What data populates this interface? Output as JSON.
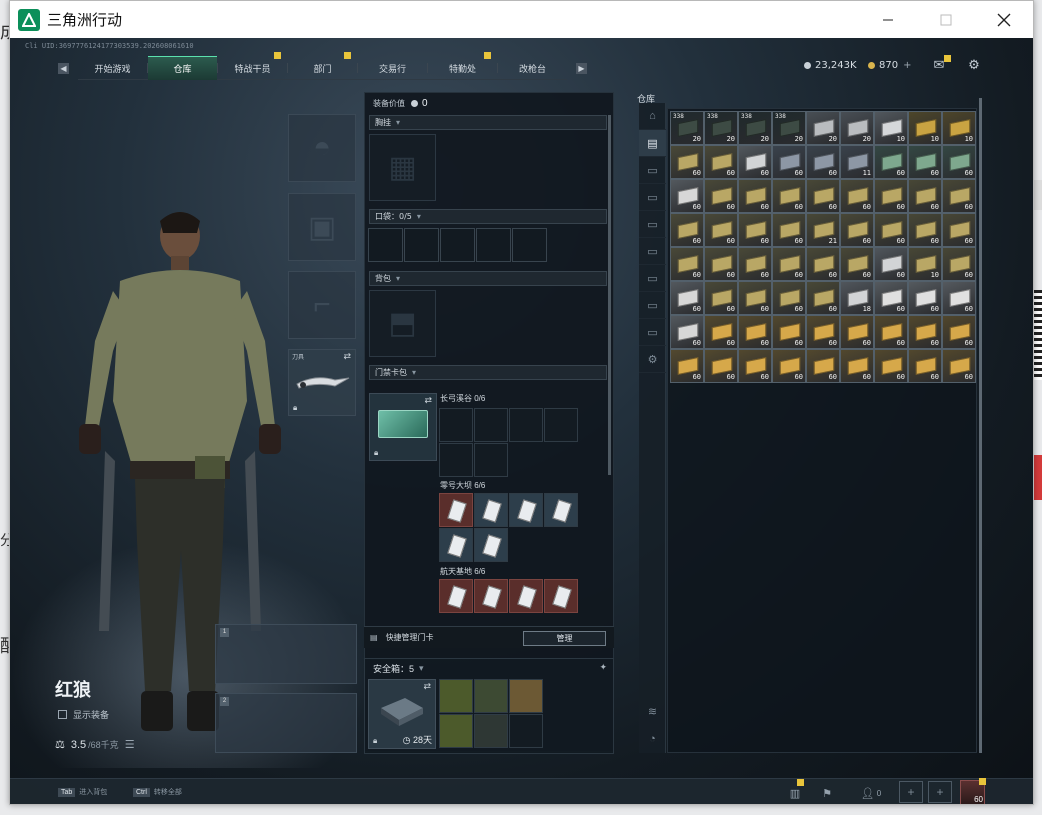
{
  "background": {
    "frag_top_left": "成",
    "frag_left_mid": "分",
    "frag_left_low": "醒"
  },
  "window": {
    "title": "三角洲行动"
  },
  "game": {
    "uid": "Cli UID:3697776124177303539.202608061610",
    "nav_tabs": [
      {
        "label": "开始游戏",
        "badge": false
      },
      {
        "label": "仓库",
        "badge": false,
        "active": true
      },
      {
        "label": "特战干员",
        "badge": true
      },
      {
        "label": "部门",
        "badge": true
      },
      {
        "label": "交易行",
        "badge": false
      },
      {
        "label": "特勤处",
        "badge": true
      },
      {
        "label": "改枪台",
        "badge": false
      }
    ],
    "currency": {
      "primary": "23,243K",
      "secondary": "870"
    },
    "character": {
      "name": "红狼",
      "show_gear_label": "显示装备",
      "weight": "3.5",
      "weight_max": "/68千克",
      "melee_label": "刀具"
    },
    "equipment": {
      "value_label": "装备价值",
      "value": "0",
      "chest_rig": "胸挂",
      "pockets": "口袋：0/5",
      "backpack": "背包",
      "keycard_bag": "门禁卡包",
      "key_sections": [
        {
          "label": "长弓溪谷 0/6"
        },
        {
          "label": "零号大坝 6/6"
        },
        {
          "label": "航天基地 6/6"
        }
      ],
      "quick_manage": "快捷管理门卡",
      "manage_button": "管理",
      "safe_box": "安全箱：5",
      "safe_time": "28天"
    },
    "stash": {
      "title": "仓库",
      "items": [
        {
          "tag": "338",
          "qty": "20",
          "color": "#3d4b44"
        },
        {
          "tag": "338",
          "qty": "20",
          "color": "#3d4b44"
        },
        {
          "tag": "338",
          "qty": "20",
          "color": "#3d4b44"
        },
        {
          "tag": "338",
          "qty": "20",
          "color": "#3d4b44"
        },
        {
          "tag": "",
          "qty": "20",
          "color": "#b9bcbf"
        },
        {
          "tag": "",
          "qty": "20",
          "color": "#b9bcbf"
        },
        {
          "tag": "",
          "qty": "10",
          "color": "#d6d8da"
        },
        {
          "tag": "",
          "qty": "10",
          "color": "#c9a342"
        },
        {
          "tag": "",
          "qty": "10",
          "color": "#c9a342"
        },
        {
          "tag": "",
          "qty": "60",
          "color": "#b9a765"
        },
        {
          "tag": "",
          "qty": "60",
          "color": "#b9a765"
        },
        {
          "tag": "",
          "qty": "60",
          "color": "#d2d4d6"
        },
        {
          "tag": "",
          "qty": "60",
          "color": "#8d97a5"
        },
        {
          "tag": "",
          "qty": "60",
          "color": "#8d97a5"
        },
        {
          "tag": "",
          "qty": "11",
          "color": "#8d97a5"
        },
        {
          "tag": "",
          "qty": "60",
          "color": "#7ea88e"
        },
        {
          "tag": "",
          "qty": "60",
          "color": "#7ea88e"
        },
        {
          "tag": "",
          "qty": "60",
          "color": "#7ea88e"
        },
        {
          "tag": "",
          "qty": "60",
          "color": "#d7d7d7"
        },
        {
          "tag": "",
          "qty": "60",
          "color": "#b9a765"
        },
        {
          "tag": "",
          "qty": "60",
          "color": "#b9a765"
        },
        {
          "tag": "",
          "qty": "60",
          "color": "#b9a765"
        },
        {
          "tag": "",
          "qty": "60",
          "color": "#b9a765"
        },
        {
          "tag": "",
          "qty": "60",
          "color": "#b9a765"
        },
        {
          "tag": "",
          "qty": "60",
          "color": "#b9a765"
        },
        {
          "tag": "",
          "qty": "60",
          "color": "#b9a765"
        },
        {
          "tag": "",
          "qty": "60",
          "color": "#b9a765"
        },
        {
          "tag": "",
          "qty": "60",
          "color": "#b9a765"
        },
        {
          "tag": "",
          "qty": "60",
          "color": "#b9a765"
        },
        {
          "tag": "",
          "qty": "60",
          "color": "#b9a765"
        },
        {
          "tag": "",
          "qty": "60",
          "color": "#b9a765"
        },
        {
          "tag": "",
          "qty": "21",
          "color": "#b9a765"
        },
        {
          "tag": "",
          "qty": "60",
          "color": "#b9a765"
        },
        {
          "tag": "",
          "qty": "60",
          "color": "#b9a765"
        },
        {
          "tag": "",
          "qty": "60",
          "color": "#b9a765"
        },
        {
          "tag": "",
          "qty": "60",
          "color": "#b9a765"
        },
        {
          "tag": "",
          "qty": "60",
          "color": "#b9a765"
        },
        {
          "tag": "",
          "qty": "60",
          "color": "#b9a765"
        },
        {
          "tag": "",
          "qty": "60",
          "color": "#b9a765"
        },
        {
          "tag": "",
          "qty": "60",
          "color": "#b9a765"
        },
        {
          "tag": "",
          "qty": "60",
          "color": "#b9a765"
        },
        {
          "tag": "",
          "qty": "60",
          "color": "#b9a765"
        },
        {
          "tag": "",
          "qty": "60",
          "color": "#d2d4d6"
        },
        {
          "tag": "",
          "qty": "10",
          "color": "#b9a765"
        },
        {
          "tag": "",
          "qty": "60",
          "color": "#b9a765"
        },
        {
          "tag": "",
          "qty": "60",
          "color": "#d7d7d7"
        },
        {
          "tag": "",
          "qty": "60",
          "color": "#b9a765"
        },
        {
          "tag": "",
          "qty": "60",
          "color": "#b9a765"
        },
        {
          "tag": "",
          "qty": "60",
          "color": "#b9a765"
        },
        {
          "tag": "",
          "qty": "60",
          "color": "#b9a765"
        },
        {
          "tag": "",
          "qty": "18",
          "color": "#d2d4d6"
        },
        {
          "tag": "",
          "qty": "60",
          "color": "#e0e0e0"
        },
        {
          "tag": "",
          "qty": "60",
          "color": "#e0e0e0"
        },
        {
          "tag": "",
          "qty": "60",
          "color": "#e0e0e0"
        },
        {
          "tag": "",
          "qty": "60",
          "color": "#d7d7d7"
        },
        {
          "tag": "",
          "qty": "60",
          "color": "#d6a84a"
        },
        {
          "tag": "",
          "qty": "60",
          "color": "#d6a84a"
        },
        {
          "tag": "",
          "qty": "60",
          "color": "#d6a84a"
        },
        {
          "tag": "",
          "qty": "60",
          "color": "#d6a84a"
        },
        {
          "tag": "",
          "qty": "60",
          "color": "#d6a84a"
        },
        {
          "tag": "",
          "qty": "60",
          "color": "#d6a84a"
        },
        {
          "tag": "",
          "qty": "60",
          "color": "#d6a84a"
        },
        {
          "tag": "",
          "qty": "60",
          "color": "#d6a84a"
        },
        {
          "tag": "",
          "qty": "60",
          "color": "#d6a84a"
        },
        {
          "tag": "",
          "qty": "60",
          "color": "#d6a84a"
        },
        {
          "tag": "",
          "qty": "60",
          "color": "#d6a84a"
        },
        {
          "tag": "",
          "qty": "60",
          "color": "#d6a84a"
        },
        {
          "tag": "",
          "qty": "60",
          "color": "#d6a84a"
        },
        {
          "tag": "",
          "qty": "60",
          "color": "#d6a84a"
        },
        {
          "tag": "",
          "qty": "60",
          "color": "#d6a84a"
        },
        {
          "tag": "",
          "qty": "60",
          "color": "#d6a84a"
        },
        {
          "tag": "",
          "qty": "60",
          "color": "#d6a84a"
        }
      ]
    },
    "bottombar": {
      "hint1_key": "Tab",
      "hint1_text": "进入背包",
      "hint2_key": "Ctrl",
      "hint2_text": "转移全部",
      "friends": "0",
      "level": "60"
    },
    "colors": {
      "accent": "#5be1ae",
      "badge": "#e9c53b"
    }
  }
}
